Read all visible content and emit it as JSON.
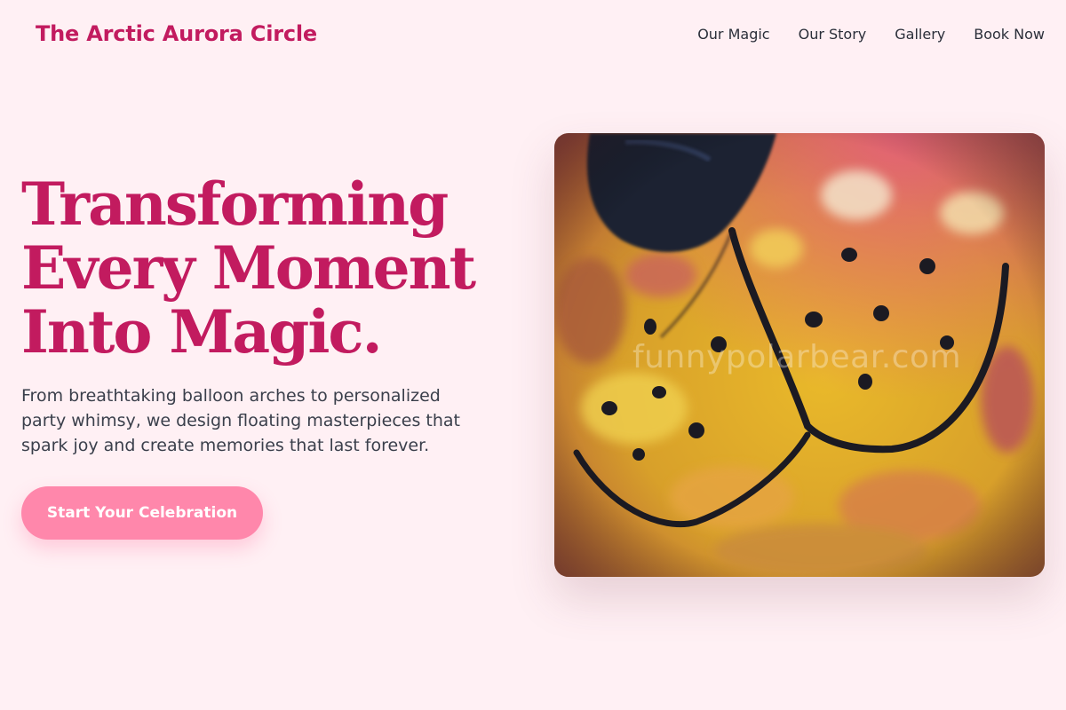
{
  "header": {
    "brand": "The Arctic Aurora Circle",
    "nav": [
      {
        "label": "Our Magic"
      },
      {
        "label": "Our Story"
      },
      {
        "label": "Gallery"
      },
      {
        "label": "Book Now"
      }
    ]
  },
  "hero": {
    "title_lines": [
      "Transforming",
      "Every Moment",
      "Into Magic."
    ],
    "subtitle": "From breathtaking balloon arches to personalized party whimsy, we design floating masterpieces that spark joy and create memories that last forever.",
    "cta_label": "Start Your Celebration",
    "image": {
      "description_icon": "polar-bear-snout-photo",
      "watermark": "funnypolarbear.com"
    }
  },
  "colors": {
    "background": "#fff0f4",
    "brand": "#c21b5f",
    "cta": "#ff87ab",
    "text": "#3a3f4b"
  }
}
